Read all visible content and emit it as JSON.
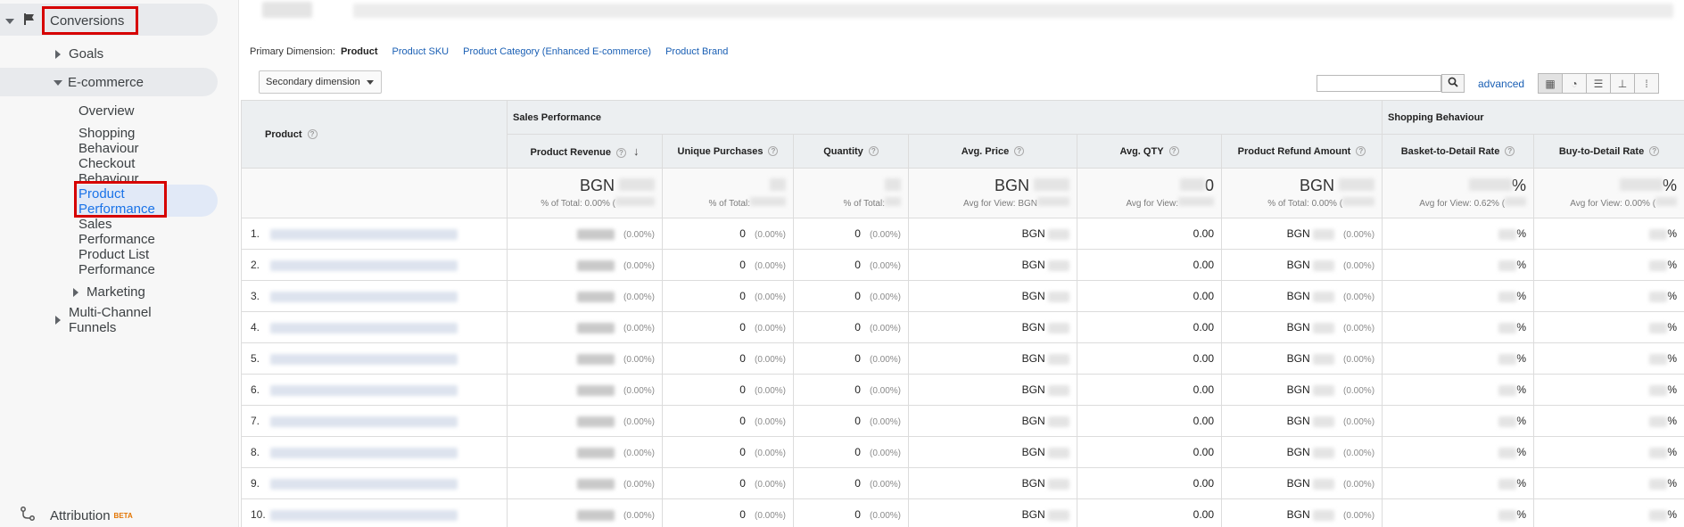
{
  "sidebar": {
    "conversions": "Conversions",
    "goals": "Goals",
    "ecommerce": "E-commerce",
    "items": [
      {
        "label": "Overview"
      },
      {
        "label": "Shopping Behaviour"
      },
      {
        "label": "Checkout Behaviour"
      },
      {
        "label": "Product Performance"
      },
      {
        "label": "Sales Performance"
      },
      {
        "label": "Product List Performance"
      }
    ],
    "marketing": "Marketing",
    "multichannel": "Multi-Channel Funnels",
    "attribution": "Attribution",
    "beta": "BETA"
  },
  "dimensions": {
    "label": "Primary Dimension:",
    "current": "Product",
    "options": [
      "Product SKU",
      "Product Category (Enhanced E-commerce)",
      "Product Brand"
    ]
  },
  "toolbar": {
    "secondary": "Secondary dimension",
    "advanced": "advanced"
  },
  "table": {
    "product_header": "Product",
    "group_sales": "Sales Performance",
    "group_shopping": "Shopping Behaviour",
    "columns": [
      "Product Revenue",
      "Unique Purchases",
      "Quantity",
      "Avg. Price",
      "Avg. QTY",
      "Product Refund Amount",
      "Basket-to-Detail Rate",
      "Buy-to-Detail Rate"
    ],
    "totals": {
      "revenue_big": "BGN",
      "revenue_sub": "% of Total: 0.00% (",
      "unique_sub": "% of Total:",
      "quantity_sub": "% of Total:",
      "avgprice_big": "BGN",
      "avgprice_sub": "Avg for View: BGN",
      "avgqty_big": "0",
      "avgqty_sub": "Avg for View:",
      "refund_big": "BGN",
      "refund_sub": "% of Total: 0.00% (",
      "basket_big": "%",
      "basket_sub": "Avg for View: 0.62% (",
      "buy_big": "%",
      "buy_sub": "Avg for View: 0.00% ("
    },
    "rows": [
      {
        "n": "1.",
        "unique": "0",
        "qty": "0",
        "price": "BGN",
        "avgqty": "0.00",
        "refund": "BGN",
        "pct": "(0.00%)",
        "basket": "%",
        "buy": "%"
      },
      {
        "n": "2.",
        "unique": "0",
        "qty": "0",
        "price": "BGN",
        "avgqty": "0.00",
        "refund": "BGN",
        "pct": "(0.00%)",
        "basket": "%",
        "buy": "%"
      },
      {
        "n": "3.",
        "unique": "0",
        "qty": "0",
        "price": "BGN",
        "avgqty": "0.00",
        "refund": "BGN",
        "pct": "(0.00%)",
        "basket": "%",
        "buy": "%"
      },
      {
        "n": "4.",
        "unique": "0",
        "qty": "0",
        "price": "BGN",
        "avgqty": "0.00",
        "refund": "BGN",
        "pct": "(0.00%)",
        "basket": "%",
        "buy": "%"
      },
      {
        "n": "5.",
        "unique": "0",
        "qty": "0",
        "price": "BGN",
        "avgqty": "0.00",
        "refund": "BGN",
        "pct": "(0.00%)",
        "basket": "%",
        "buy": "%"
      },
      {
        "n": "6.",
        "unique": "0",
        "qty": "0",
        "price": "BGN",
        "avgqty": "0.00",
        "refund": "BGN",
        "pct": "(0.00%)",
        "basket": "%",
        "buy": "%"
      },
      {
        "n": "7.",
        "unique": "0",
        "qty": "0",
        "price": "BGN",
        "avgqty": "0.00",
        "refund": "BGN",
        "pct": "(0.00%)",
        "basket": "%",
        "buy": "%"
      },
      {
        "n": "8.",
        "unique": "0",
        "qty": "0",
        "price": "BGN",
        "avgqty": "0.00",
        "refund": "BGN",
        "pct": "(0.00%)",
        "basket": "%",
        "buy": "%"
      },
      {
        "n": "9.",
        "unique": "0",
        "qty": "0",
        "price": "BGN",
        "avgqty": "0.00",
        "refund": "BGN",
        "pct": "(0.00%)",
        "basket": "%",
        "buy": "%"
      },
      {
        "n": "10.",
        "unique": "0",
        "qty": "0",
        "price": "BGN",
        "avgqty": "0.00",
        "refund": "BGN",
        "pct": "(0.00%)",
        "basket": "%",
        "buy": "%"
      }
    ]
  },
  "colors": {
    "accent": "#1a73e8",
    "highlight": "#d60000",
    "link": "#1a5fb4"
  }
}
